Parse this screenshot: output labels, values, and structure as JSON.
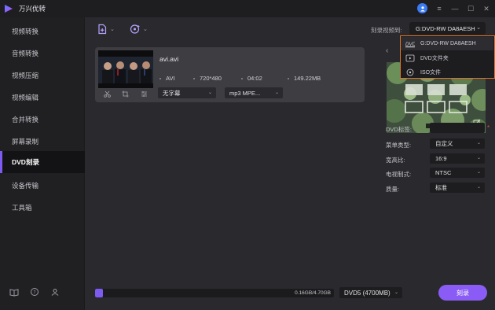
{
  "app": {
    "title": "万兴优转"
  },
  "window_controls": [
    "user-icon",
    "menu-icon",
    "minimize-icon",
    "maximize-icon",
    "close-icon"
  ],
  "sidebar": {
    "items": [
      {
        "label": "视频转换",
        "active": false
      },
      {
        "label": "音频转换",
        "active": false
      },
      {
        "label": "视频压缩",
        "active": false
      },
      {
        "label": "视频编辑",
        "active": false
      },
      {
        "label": "合并转换",
        "active": false
      },
      {
        "label": "屏幕录制",
        "active": false
      },
      {
        "label": "DVD刻录",
        "active": true
      },
      {
        "label": "设备传输",
        "active": false
      },
      {
        "label": "工具箱",
        "active": false
      }
    ],
    "bottom_icons": [
      "book-icon",
      "help-icon",
      "account-icon"
    ]
  },
  "toolbar": {
    "add_file_icon": "add-file-icon",
    "add_disc_icon": "load-disc-icon"
  },
  "burn_to": {
    "label": "刻录视频到:",
    "selected": "G:DVD-RW DA8AESH",
    "options": [
      {
        "label": "G:DVD-RW DA8AESH",
        "icon": "dvd-drive-icon"
      },
      {
        "label": "DVD文件夹",
        "icon": "folder-play-icon"
      },
      {
        "label": "ISO文件",
        "icon": "iso-disc-icon"
      }
    ]
  },
  "file": {
    "name": "avi.avi",
    "format": "AVI",
    "resolution": "720*480",
    "duration": "04:02",
    "size": "149.22MB",
    "subtitle_select": "无字幕",
    "audio_select": "mp3 MPE..."
  },
  "settings": {
    "dvd_label": {
      "label": "DVD标签:",
      "value": ""
    },
    "menu_type": {
      "label": "菜单类型:",
      "value": "自定义"
    },
    "aspect": {
      "label": "宽高比:",
      "value": "16:9"
    },
    "tv_standard": {
      "label": "电视制式:",
      "value": "NTSC"
    },
    "quality": {
      "label": "质量:",
      "value": "标准"
    }
  },
  "bottom": {
    "progress_text": "0.16GB/4.70GB",
    "progress_fraction": 0.034,
    "disc_type": "DVD5 (4700MB)",
    "burn_button": "刻录"
  },
  "colors": {
    "accent": "#7d5bf0",
    "highlight_border": "#e0722a",
    "sidebar_bg": "#202023"
  }
}
